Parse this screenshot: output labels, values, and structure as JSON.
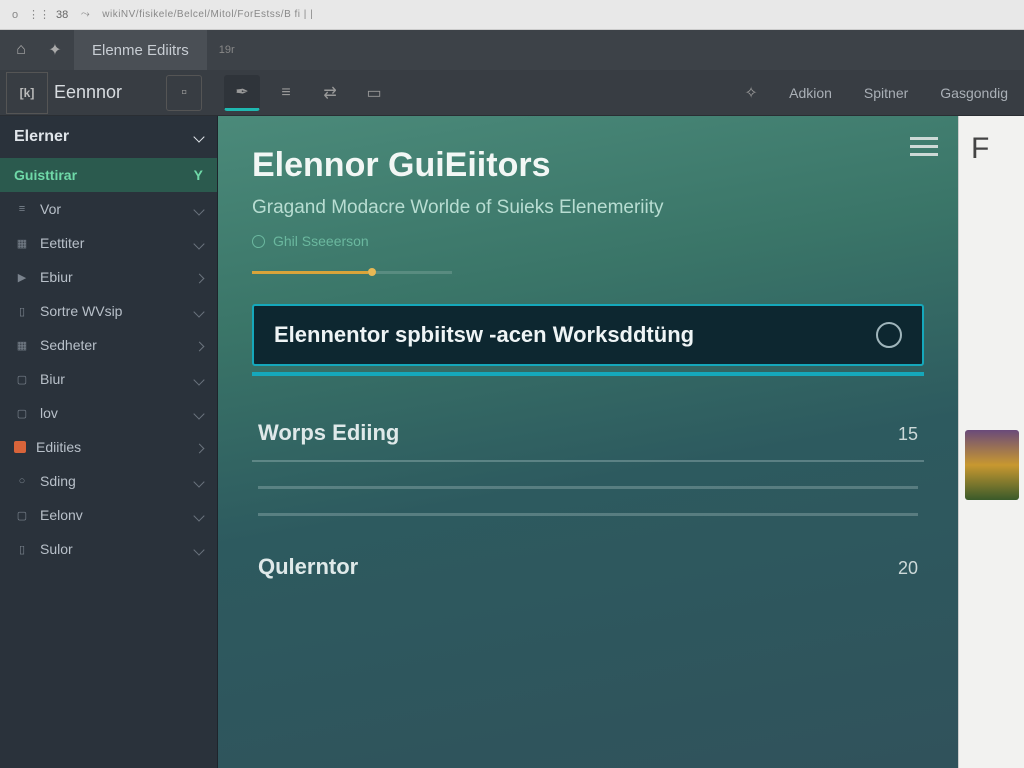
{
  "browser": {
    "num": "38",
    "url": "wikiNV/fisikele/Belcel/Mitol/ForEstss/B fi | |"
  },
  "tabbar": {
    "tab1": "Elenme Ediitrs",
    "newtab": "19r"
  },
  "toolbar": {
    "brand": "Eennnor",
    "links": [
      "Adkion",
      "Spitner",
      "Gasgondig"
    ]
  },
  "sidebar": {
    "section1": "Elerner",
    "accent": "Guisttirar",
    "items": [
      {
        "ico": "≡",
        "label": "Vor"
      },
      {
        "ico": "▦",
        "label": "Eettiter"
      },
      {
        "ico": "▶",
        "label": "Ebiur"
      },
      {
        "ico": "▯",
        "label": "Sortre WVsip"
      },
      {
        "ico": "▦",
        "label": "Sedheter"
      },
      {
        "ico": "▢",
        "label": "Biur"
      },
      {
        "ico": "▢",
        "label": "lov"
      },
      {
        "ico": "■",
        "label": "Ediities",
        "orange": true
      },
      {
        "ico": "○",
        "label": "Sding"
      },
      {
        "ico": "▢",
        "label": "Eelonv"
      },
      {
        "ico": "▯",
        "label": "Sulor"
      }
    ]
  },
  "hero": {
    "title": "Elennor GuiEiitors",
    "subtitle": "Gragand Modacre Worlde of Suieks Elenemeriity",
    "meta": "Ghil Sseeerson"
  },
  "banner": {
    "title": "Elennentor spbiitsw -acen Worksddtüng"
  },
  "sections": [
    {
      "label": "Worps Ediing",
      "value": "15"
    },
    {
      "label": "Qulerntor",
      "value": "20"
    }
  ],
  "rightpane": {
    "letter": "F"
  }
}
